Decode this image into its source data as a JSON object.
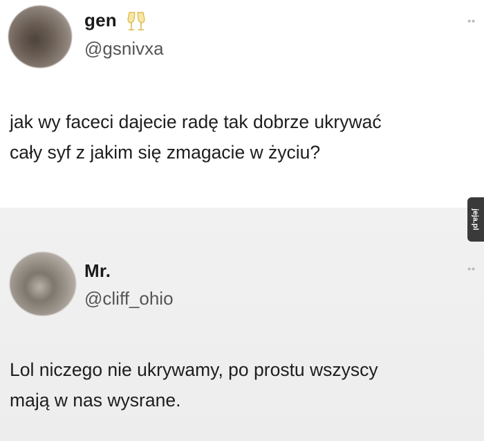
{
  "posts": [
    {
      "display_name": "gen",
      "emoji": "clinking-glasses-icon",
      "handle": "@gsnivxa",
      "text_lines": [
        "jak wy faceci dajecie radę tak dobrze ukrywać",
        "cały syf z jakim się zmagacie w życiu?"
      ]
    },
    {
      "display_name": "Mr.",
      "handle": "@cliff_ohio",
      "text_lines": [
        "Lol niczego nie ukrywamy, po prostu wszyscy",
        "mają w nas wysrane."
      ]
    }
  ],
  "more_icon": "••",
  "watermark": "jeja.pl"
}
